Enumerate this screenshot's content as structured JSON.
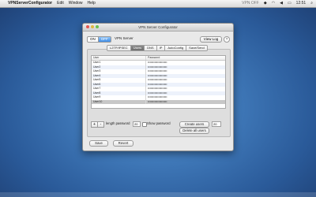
{
  "menubar": {
    "apple_glyph": "",
    "app_name": "VPNServerConfigurator",
    "menus": [
      "Edit",
      "Window",
      "Help"
    ],
    "status_text": "VPN OFF",
    "time": "12:51"
  },
  "window": {
    "title": "VPN Server Configurator",
    "toggle_on": "ON",
    "toggle_off": "OFF",
    "server_label": "VPN Server",
    "view_log": "View Log",
    "help": "?",
    "tabs": [
      "L2TP/IPSEC",
      "Users",
      "DNS",
      "IP",
      "AutoConfig",
      "Save/Send"
    ],
    "active_tab": "Users",
    "table": {
      "headers": [
        "User",
        "Password"
      ],
      "rows": [
        {
          "user": "User1",
          "password": "••••••••••••••••••••"
        },
        {
          "user": "User2",
          "password": "••••••••••••••••••••"
        },
        {
          "user": "User3",
          "password": "••••••••••••••••••••"
        },
        {
          "user": "User4",
          "password": "••••••••••••••••••••"
        },
        {
          "user": "User5",
          "password": "••••••••••••••••••••"
        },
        {
          "user": "User6",
          "password": "••••••••••••••••••••"
        },
        {
          "user": "User7",
          "password": "••••••••••••••••••••"
        },
        {
          "user": "User8",
          "password": "••••••••••••••••••••"
        },
        {
          "user": "User9",
          "password": "••••••••••••••••••••"
        },
        {
          "user": "User10",
          "password": "••••••••••••••••••••"
        }
      ]
    },
    "add": "+",
    "remove": "-",
    "length_label": "length password",
    "length_value": "20",
    "show_password": "Show password",
    "create_users": "Create users",
    "create_count": "20",
    "delete_all": "Delete all users",
    "save": "Save",
    "revert": "Revert"
  }
}
